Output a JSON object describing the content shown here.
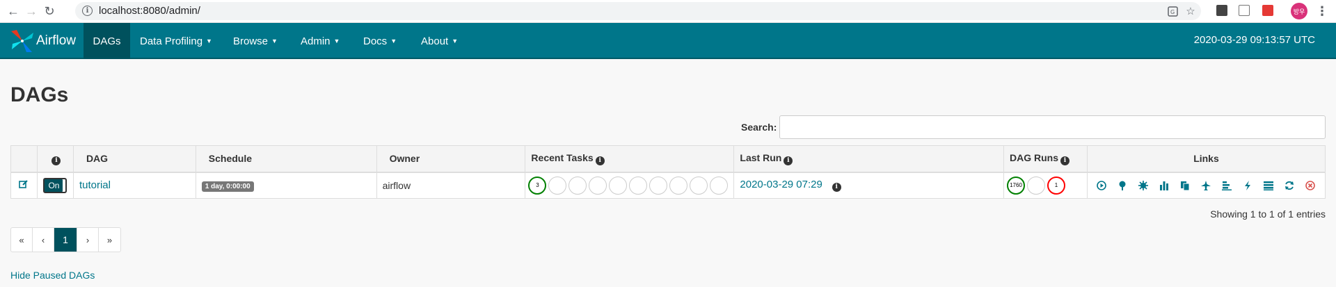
{
  "browser": {
    "url": "localhost:8080/admin/",
    "profile_initials": "방우"
  },
  "navbar": {
    "brand": "Airflow",
    "items": [
      {
        "label": "DAGs",
        "active": true
      },
      {
        "label": "Data Profiling"
      },
      {
        "label": "Browse"
      },
      {
        "label": "Admin"
      },
      {
        "label": "Docs"
      },
      {
        "label": "About"
      }
    ],
    "clock": "2020-03-29 09:13:57 UTC"
  },
  "page": {
    "title": "DAGs",
    "search_label": "Search:",
    "search_value": ""
  },
  "table": {
    "headers": {
      "dag": "DAG",
      "schedule": "Schedule",
      "owner": "Owner",
      "recent_tasks": "Recent Tasks",
      "last_run": "Last Run",
      "dag_runs": "DAG Runs",
      "links": "Links"
    },
    "rows": [
      {
        "toggle": "On",
        "dag": "tutorial",
        "schedule": "1 day, 0:00:00",
        "owner": "airflow",
        "recent_tasks_success": "3",
        "last_run": "2020-03-29 07:29",
        "dag_runs_success": "1760",
        "dag_runs_failed": "1"
      }
    ]
  },
  "footer": {
    "showing": "Showing 1 to 1 of 1 entries",
    "pager": [
      "«",
      "‹",
      "1",
      "›",
      "»"
    ],
    "hide_paused": "Hide Paused DAGs"
  }
}
